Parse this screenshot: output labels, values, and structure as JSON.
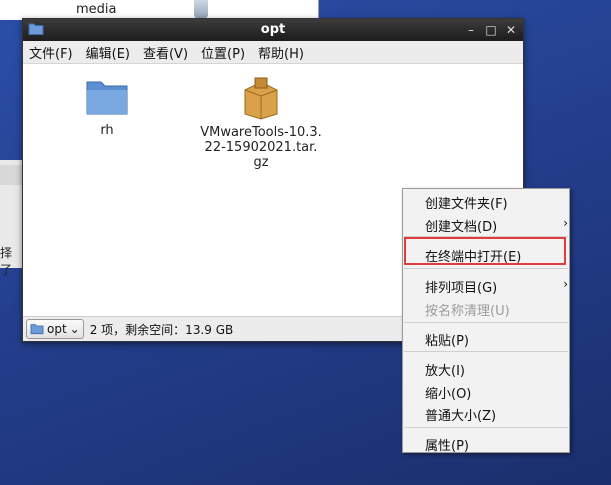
{
  "background": {
    "top_item_label": "media",
    "side_panel_text": "择了"
  },
  "window": {
    "title": "opt",
    "controls": [
      "–",
      "□",
      "✕"
    ],
    "menu": [
      "文件(F)",
      "编辑(E)",
      "查看(V)",
      "位置(P)",
      "帮助(H)"
    ],
    "items": [
      {
        "label": "rh",
        "icon": "folder-icon"
      },
      {
        "label_lines": [
          "VMwareTools-10.3.",
          "22-15902021.tar.",
          "gz"
        ],
        "icon": "archive-icon"
      }
    ],
    "statusbar": {
      "path_label": "opt",
      "status_text": "2 项，剩余空间：13.9 GB"
    }
  },
  "context_menu": {
    "items": [
      {
        "label": "创建文件夹(F)",
        "underline": "F"
      },
      {
        "label": "创建文档(D)",
        "underline": "D",
        "submenu": true
      },
      {
        "label": "在终端中打开(E)",
        "underline": "E",
        "highlighted": true
      },
      {
        "label": "排列项目(G)",
        "underline": "G",
        "submenu": true
      },
      {
        "label": "按名称清理(U)",
        "disabled": true
      },
      {
        "label": "粘贴(P)",
        "underline": "P"
      },
      {
        "label": "放大(I)",
        "underline": "I"
      },
      {
        "label": "缩小(O)",
        "underline": "O"
      },
      {
        "label": "普通大小(Z)",
        "underline": "Z"
      },
      {
        "label": "属性(P)",
        "underline": "P"
      }
    ]
  },
  "colors": {
    "desktop": "#243f8e",
    "titlebar": "#2a2a2a",
    "highlight_border": "#e23b3b",
    "folder": "#5b8fd1"
  }
}
